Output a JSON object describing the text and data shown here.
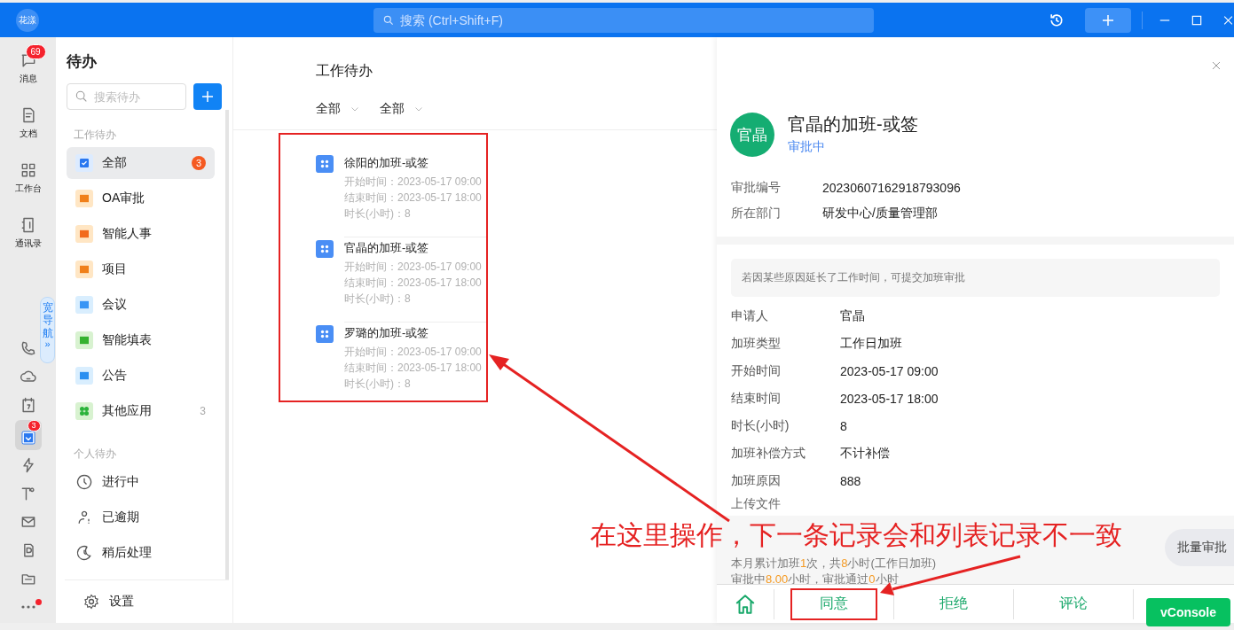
{
  "top_bar": {
    "logo": "花漾",
    "search_placeholder": "搜索 (Ctrl+Shift+F)"
  },
  "rail": [
    {
      "label": "消息",
      "badge": "69",
      "selected": false,
      "dot": false
    },
    {
      "label": "文档",
      "selected": false,
      "dot": false
    },
    {
      "label": "工作台",
      "selected": false,
      "dot": false
    },
    {
      "label": "通讯录",
      "selected": false,
      "dot": false
    },
    {
      "selected": false,
      "dot": false
    },
    {
      "selected": false,
      "dot": false
    },
    {
      "selected": false,
      "dot": false
    },
    {
      "badge": "3",
      "selected": true,
      "dot": false
    },
    {
      "selected": false,
      "dot": false
    },
    {
      "selected": false,
      "dot": false
    },
    {
      "selected": false,
      "dot": false
    },
    {
      "selected": false,
      "dot": false
    },
    {
      "selected": false,
      "dot": false
    },
    {
      "selected": false,
      "dot": true
    }
  ],
  "wide_nav": {
    "label": "宽导航",
    "arrow": "»"
  },
  "sidebar": {
    "title": "待办",
    "search_placeholder": "搜索待办",
    "work_section": "工作待办",
    "work_items": [
      {
        "label": "全部",
        "badge": "3",
        "selected": true
      },
      {
        "label": "OA审批",
        "selected": false
      },
      {
        "label": "智能人事",
        "selected": false
      },
      {
        "label": "项目",
        "selected": false
      },
      {
        "label": "会议",
        "selected": false
      },
      {
        "label": "智能填表",
        "selected": false
      },
      {
        "label": "公告",
        "selected": false
      },
      {
        "label": "其他应用",
        "count": "3",
        "selected": false
      }
    ],
    "personal_section": "个人待办",
    "personal_items": [
      {
        "label": "进行中",
        "selected": false
      },
      {
        "label": "已逾期",
        "selected": false
      },
      {
        "label": "稍后处理",
        "selected": false
      }
    ],
    "settings": "设置"
  },
  "list": {
    "title": "工作待办",
    "filters": [
      "全部",
      "全部"
    ],
    "highlighted": true,
    "items": [
      {
        "title": "徐阳的加班-或签",
        "lines": [
          "开始时间：2023-05-17 09:00",
          "结束时间：2023-05-17 18:00",
          "时长(小时)：8"
        ]
      },
      {
        "title": "官晶的加班-或签",
        "lines": [
          "开始时间：2023-05-17 09:00",
          "结束时间：2023-05-17 18:00",
          "时长(小时)：8"
        ]
      },
      {
        "title": "罗璐的加班-或签",
        "lines": [
          "开始时间：2023-05-17 09:00",
          "结束时间：2023-05-17 18:00",
          "时长(小时)：8"
        ]
      }
    ]
  },
  "detail": {
    "avatar": "官晶",
    "title": "官晶的加班-或签",
    "status": "审批中",
    "meta": [
      {
        "label": "审批编号",
        "value": "20230607162918793096"
      },
      {
        "label": "所在部门",
        "value": "研发中心/质量管理部"
      }
    ],
    "hint": "若因某些原因延长了工作时间，可提交加班审批",
    "fields": [
      {
        "label": "申请人",
        "value": "官晶"
      },
      {
        "label": "加班类型",
        "value": "工作日加班"
      },
      {
        "label": "开始时间",
        "value": "2023-05-17 09:00"
      },
      {
        "label": "结束时间",
        "value": "2023-05-17 18:00"
      },
      {
        "label": "时长(小时)",
        "value": "8"
      },
      {
        "label": "加班补偿方式",
        "value": "不计补偿"
      },
      {
        "label": "加班原因",
        "value": "888"
      }
    ],
    "upload_label": "上传文件",
    "summary": [
      [
        {
          "text": "本月累计加班",
          "accent": false
        },
        {
          "text": "1",
          "accent": true
        },
        {
          "text": "次，共",
          "accent": false
        },
        {
          "text": "8",
          "accent": true
        },
        {
          "text": "小时(工作日加班)",
          "accent": false
        }
      ],
      [
        {
          "text": "审批中",
          "accent": false
        },
        {
          "text": "8.00",
          "accent": true
        },
        {
          "text": "小时，审批通过",
          "accent": false
        },
        {
          "text": "0",
          "accent": true
        },
        {
          "text": "小时",
          "accent": false
        }
      ]
    ],
    "actions": [
      {
        "label": "同意",
        "highlighted": true
      },
      {
        "label": "拒绝",
        "highlighted": false
      },
      {
        "label": "评论",
        "highlighted": false
      }
    ],
    "batch_button": "批量审批"
  },
  "vconsole": "vConsole",
  "annotation": {
    "note": "在这里操作，下一条记录会和列表记录不一致"
  }
}
